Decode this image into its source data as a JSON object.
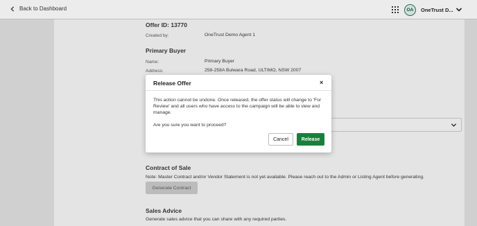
{
  "topbar": {
    "back_label": "Back to Dashboard",
    "avatar_initials": "OA",
    "org_name": "OneTrust D..."
  },
  "offer": {
    "title": "Offer ID: 13770",
    "created_by_label": "Created by:",
    "created_by_value": "OneTrust Demo Agent 1"
  },
  "primary_buyer": {
    "heading": "Primary Buyer",
    "name_label": "Name:",
    "name_value": "Primary Buyer",
    "address_label": "Address:",
    "address_value": "258-258A Bulwara Road, ULTIMO, NSW 2007"
  },
  "contract": {
    "heading": "Contract of Sale",
    "note": "Note: Master Contract and/or Vendor Statement is not yet available. Please reach out to the Admin or Listing Agent before generating.",
    "generate_button": "Generate Contract"
  },
  "sales_advice": {
    "heading": "Sales Advice",
    "text": "Generate sales advice that you can share with any required parties."
  },
  "modal": {
    "title": "Release Offer",
    "close_glyph": "×",
    "body": "This action cannot be undone. Once released, the offer status will change to 'For Review' and all users who have access to the campaign will be able to view and manage.",
    "question": "Are you sure you want to proceed?",
    "cancel_label": "Cancel",
    "release_label": "Release"
  },
  "colors": {
    "accent": "#1a7f3c",
    "overlay": "#d0d0d0"
  }
}
